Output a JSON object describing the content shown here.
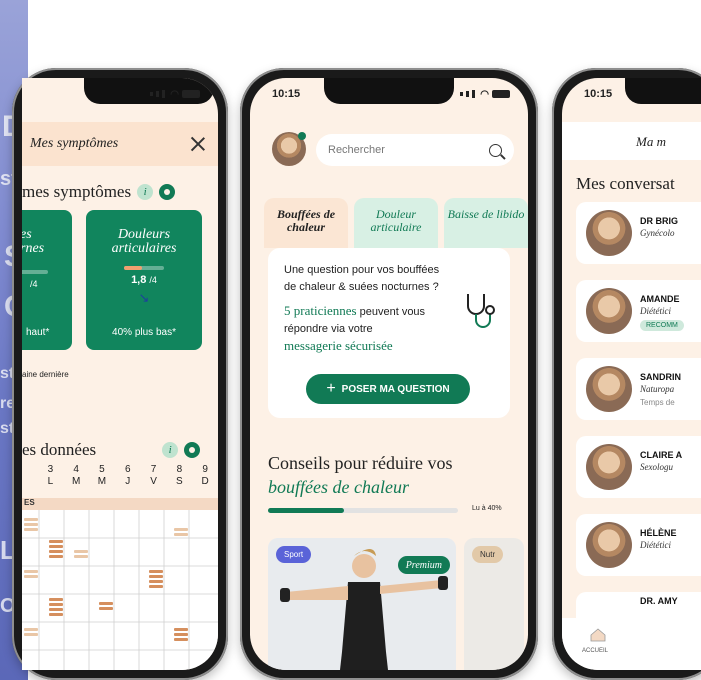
{
  "background": {
    "fragments": [
      "D",
      "st",
      "S",
      "C",
      "st",
      "re",
      "sth",
      "L",
      "O,"
    ]
  },
  "status": {
    "time": "10:15"
  },
  "phone1": {
    "title": "Mes symptômes",
    "section_title": "mes symptômes",
    "card_left": {
      "title": "es\nrnes",
      "score": "/4",
      "foot": "haut*"
    },
    "card_right": {
      "title": "Douleurs\narticulaires",
      "score": "1,8",
      "score_max": "/4",
      "foot": "40% plus bas*",
      "level_fraction": 0.45
    },
    "week_note": "aine dernière",
    "data_title": "es données",
    "days": [
      {
        "num": "3",
        "letter": "L"
      },
      {
        "num": "4",
        "letter": "M"
      },
      {
        "num": "5",
        "letter": "M"
      },
      {
        "num": "6",
        "letter": "J"
      },
      {
        "num": "7",
        "letter": "V"
      },
      {
        "num": "8",
        "letter": "S"
      },
      {
        "num": "9",
        "letter": "D"
      }
    ],
    "row_label": "ES"
  },
  "phone2": {
    "search_placeholder": "Rechercher",
    "tabs": [
      {
        "label": "Bouffées de chaleur",
        "active": true
      },
      {
        "label": "Douleur articulaire",
        "active": false
      },
      {
        "label": "Baisse de libido",
        "active": false
      }
    ],
    "question": {
      "text": "Une question pour vos bouffées de chaleur & suées nocturnes ?",
      "practitioners": "5 praticiennes",
      "practitioners_rest": " peuvent vous répondre via votre",
      "messaging": "messagerie sécurisée",
      "button": "POSER MA QUESTION"
    },
    "advice_title": "Conseils pour réduire vos",
    "advice_subtitle": "bouffées de chaleur",
    "progress_label": "Lu à 40%",
    "progress_fraction": 0.4,
    "article": {
      "tag": "Sport",
      "badge": "Premium"
    },
    "article2_tag": "Nutr",
    "colors": {
      "accent": "#117a55",
      "tag_blue": "#5a63d8"
    }
  },
  "phone3": {
    "header": "Ma m",
    "title": "Mes conversat",
    "conversations": [
      {
        "name": "DR BRIG",
        "role": "Gynécolo"
      },
      {
        "name": "AMANDE",
        "role": "Diététici",
        "badge": "RECOMM"
      },
      {
        "name": "SANDRIN",
        "role": "Naturopa",
        "extra": "Temps de"
      },
      {
        "name": "CLAIRE A",
        "role": "Sexologu"
      },
      {
        "name": "HÉLÈNE",
        "role": "Diététici"
      },
      {
        "name": "DR. AMY",
        "role": ""
      }
    ],
    "nav_home": "ACCUEIL"
  }
}
